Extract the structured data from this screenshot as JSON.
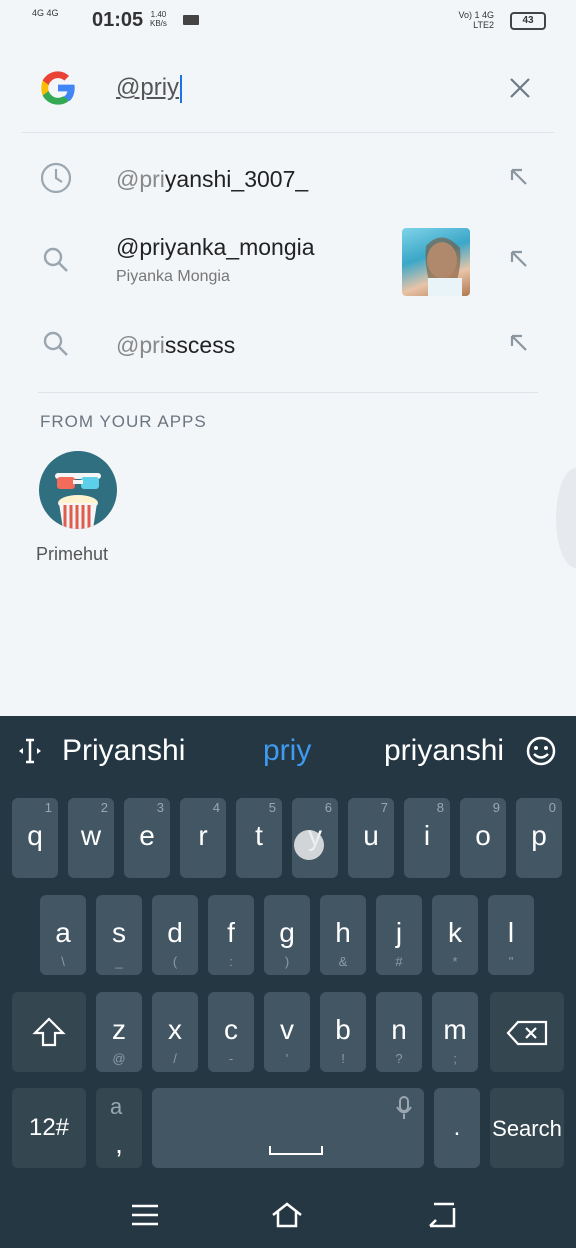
{
  "status": {
    "network": "4G 4G",
    "time": "01:05",
    "speed_value": "1.40",
    "speed_unit": "KB/s",
    "right_top": "Vo) 1 4G",
    "right_bottom": "LTE2",
    "battery": "43"
  },
  "search": {
    "query_typed": "@priy"
  },
  "suggestions": [
    {
      "prefix": "@pri",
      "rest": "yanshi_3007_",
      "icon": "history-icon"
    },
    {
      "prefix": "@priyanka_mongia",
      "rest": "",
      "subtitle": "Piyanka Mongia",
      "icon": "search-icon"
    },
    {
      "prefix": "@pri",
      "rest": "sscess",
      "icon": "search-icon"
    }
  ],
  "apps": {
    "header": "FROM YOUR APPS",
    "app_label": "Primehut"
  },
  "keyboard": {
    "suggestions": [
      "Priyanshi",
      "priy",
      "priyanshi"
    ],
    "row1": [
      {
        "ch": "q",
        "num": "1"
      },
      {
        "ch": "w",
        "num": "2"
      },
      {
        "ch": "e",
        "num": "3"
      },
      {
        "ch": "r",
        "num": "4"
      },
      {
        "ch": "t",
        "num": "5"
      },
      {
        "ch": "y",
        "num": "6"
      },
      {
        "ch": "u",
        "num": "7"
      },
      {
        "ch": "i",
        "num": "8"
      },
      {
        "ch": "o",
        "num": "9"
      },
      {
        "ch": "p",
        "num": "0"
      }
    ],
    "row2": [
      {
        "ch": "a",
        "sym": "\\"
      },
      {
        "ch": "s",
        "sym": "_"
      },
      {
        "ch": "d",
        "sym": "("
      },
      {
        "ch": "f",
        "sym": ":"
      },
      {
        "ch": "g",
        "sym": ")"
      },
      {
        "ch": "h",
        "sym": "&"
      },
      {
        "ch": "j",
        "sym": "#"
      },
      {
        "ch": "k",
        "sym": "*"
      },
      {
        "ch": "l",
        "sym": "\""
      }
    ],
    "row3": [
      {
        "ch": "z",
        "sym": "@"
      },
      {
        "ch": "x",
        "sym": "/"
      },
      {
        "ch": "c",
        "sym": "-"
      },
      {
        "ch": "v",
        "sym": "'"
      },
      {
        "ch": "b",
        "sym": "!"
      },
      {
        "ch": "n",
        "sym": "?"
      },
      {
        "ch": "m",
        "sym": ";"
      }
    ],
    "symbols_key": "12#",
    "comma_key": ",",
    "period_key": ".",
    "search_key": "Search",
    "lang_hint": "a"
  }
}
